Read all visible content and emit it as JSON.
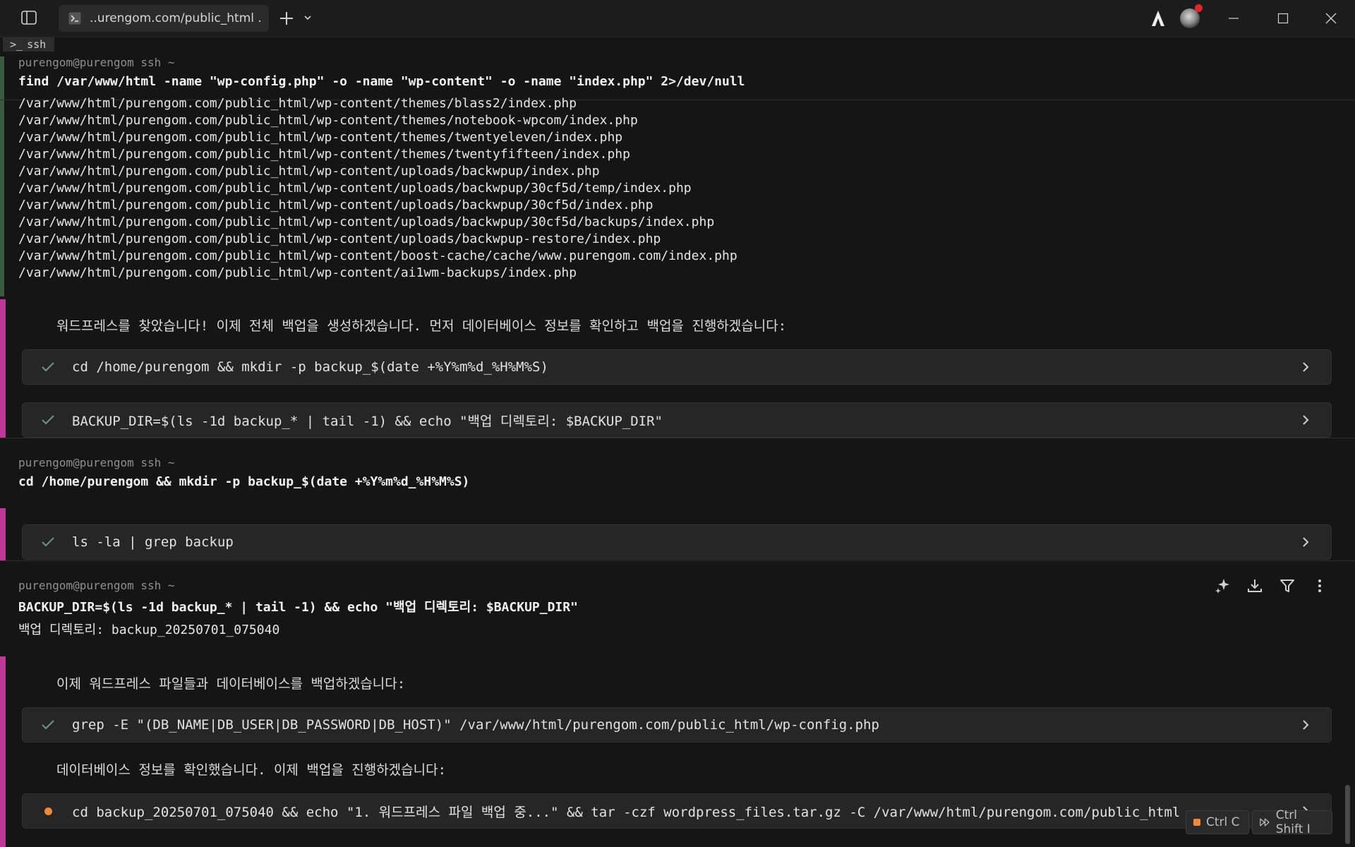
{
  "window": {
    "tab_title": "..urengom.com/public_html .",
    "profile_badge": "ssh",
    "controls": {
      "minimize": "minimize",
      "maximize": "maximize",
      "close": "close"
    }
  },
  "colors": {
    "accent_pink": "#c0399a",
    "accent_green": "#3c5a42",
    "running_orange": "#f08a34",
    "check_green": "#6a9a7e",
    "notification_red": "#e5252a"
  },
  "block1": {
    "prompt": "purengom@purengom ssh ~",
    "command": "find /var/www/html -name \"wp-config.php\" -o -name \"wp-content\" -o -name \"index.php\" 2>/dev/null",
    "output": [
      "/var/www/html/purengom.com/public_html/wp-content/themes/blass2/index.php",
      "/var/www/html/purengom.com/public_html/wp-content/themes/notebook-wpcom/index.php",
      "/var/www/html/purengom.com/public_html/wp-content/themes/twentyeleven/index.php",
      "/var/www/html/purengom.com/public_html/wp-content/themes/twentyfifteen/index.php",
      "/var/www/html/purengom.com/public_html/wp-content/uploads/backwpup/index.php",
      "/var/www/html/purengom.com/public_html/wp-content/uploads/backwpup/30cf5d/temp/index.php",
      "/var/www/html/purengom.com/public_html/wp-content/uploads/backwpup/30cf5d/index.php",
      "/var/www/html/purengom.com/public_html/wp-content/uploads/backwpup/30cf5d/backups/index.php",
      "/var/www/html/purengom.com/public_html/wp-content/uploads/backwpup-restore/index.php",
      "/var/www/html/purengom.com/public_html/wp-content/boost-cache/cache/www.purengom.com/index.php",
      "/var/www/html/purengom.com/public_html/wp-content/ai1wm-backups/index.php"
    ]
  },
  "ai1": {
    "message": "워드프레스를 찾았습니다! 이제 전체 백업을 생성하겠습니다. 먼저 데이터베이스 정보를 확인하고 백업을 진행하겠습니다:",
    "cards": [
      {
        "status": "done",
        "text": "cd /home/purengom && mkdir -p backup_$(date +%Y%m%d_%H%M%S)"
      },
      {
        "status": "done",
        "text": "BACKUP_DIR=$(ls -1d backup_* | tail -1) && echo \"백업 디렉토리: $BACKUP_DIR\""
      }
    ]
  },
  "block2": {
    "prompt": "purengom@purengom ssh ~",
    "command": "cd /home/purengom && mkdir -p backup_$(date +%Y%m%d_%H%M%S)"
  },
  "ai2": {
    "cards": [
      {
        "status": "done",
        "text": "ls -la | grep backup"
      }
    ]
  },
  "block3": {
    "prompt": "purengom@purengom ssh ~",
    "command": "BACKUP_DIR=$(ls -1d backup_* | tail -1) && echo \"백업 디렉토리: $BACKUP_DIR\"",
    "output": "백업 디렉토리: backup_20250701_075040"
  },
  "ai3": {
    "message1": "이제 워드프레스 파일들과 데이터베이스를 백업하겠습니다:",
    "card1": {
      "status": "done",
      "text": "grep -E \"(DB_NAME|DB_USER|DB_PASSWORD|DB_HOST)\" /var/www/html/purengom.com/public_html/wp-config.php"
    },
    "message2": "데이터베이스 정보를 확인했습니다. 이제 백업을 진행하겠습니다:",
    "card2": {
      "status": "running",
      "text": "cd backup_20250701_075040 && echo \"1. 워드프레스 파일 백업 중...\" && tar -czf wordpress_files.tar.gz -C /var/www/html/purengom.com/public_html"
    }
  },
  "shortcuts": {
    "interrupt": "Ctrl C",
    "takeover": "Ctrl Shift I"
  }
}
